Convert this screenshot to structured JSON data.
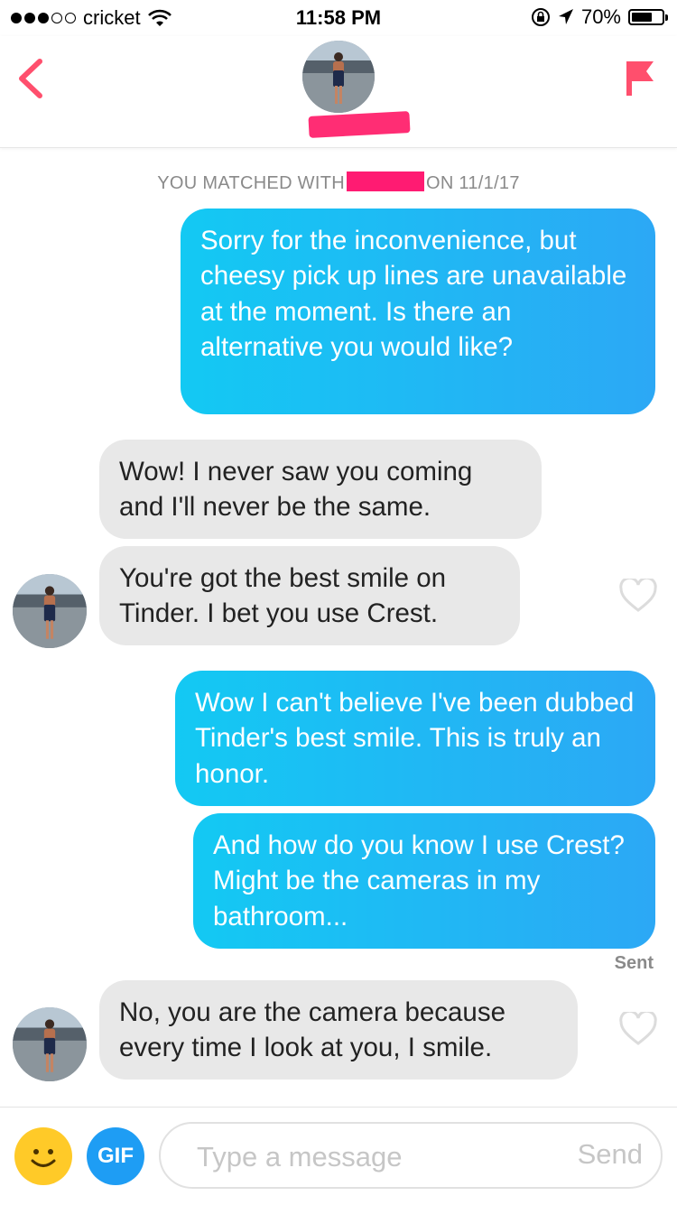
{
  "status_bar": {
    "signal_bars_filled": 3,
    "signal_bars_total": 5,
    "carrier": "cricket",
    "time": "11:58 PM",
    "battery": "70%",
    "battery_level": 0.7
  },
  "header": {
    "back_icon": "chevron-left-icon",
    "report_icon": "flag-icon",
    "accent_color": "#ff4f6d",
    "name_redaction_color": "#ff2d74"
  },
  "match_notice": {
    "prefix": "YOU MATCHED WITH",
    "suffix": "ON 11/1/17"
  },
  "messages": [
    {
      "direction": "outgoing",
      "text": "Sorry for the inconvenience, but cheesy pick up lines are unavailable at the moment. Is there an alternative you would like?"
    },
    {
      "direction": "incoming",
      "text": "Wow! I never saw you coming and I'll never be the same."
    },
    {
      "direction": "incoming",
      "text": "You're got the best smile on Tinder. I bet you use Crest."
    },
    {
      "direction": "outgoing",
      "text": "Wow I can't believe I've been dubbed Tinder's best smile. This is truly an honor."
    },
    {
      "direction": "outgoing",
      "text": "And how do you know I use Crest? Might be the cameras in my bathroom..."
    },
    {
      "direction": "incoming",
      "text": "No, you are the camera because every time I look at you, I smile."
    }
  ],
  "delivery_status": "Sent",
  "composer": {
    "emoji_icon": "smiley-icon",
    "gif_label": "GIF",
    "placeholder": "Type a message",
    "value": "",
    "send_label": "Send"
  },
  "colors": {
    "outgoing_bubble": "#1fb8f4",
    "incoming_bubble": "#e8e8e8",
    "gif_button": "#1e9df4",
    "emoji_button": "#ffca28"
  }
}
